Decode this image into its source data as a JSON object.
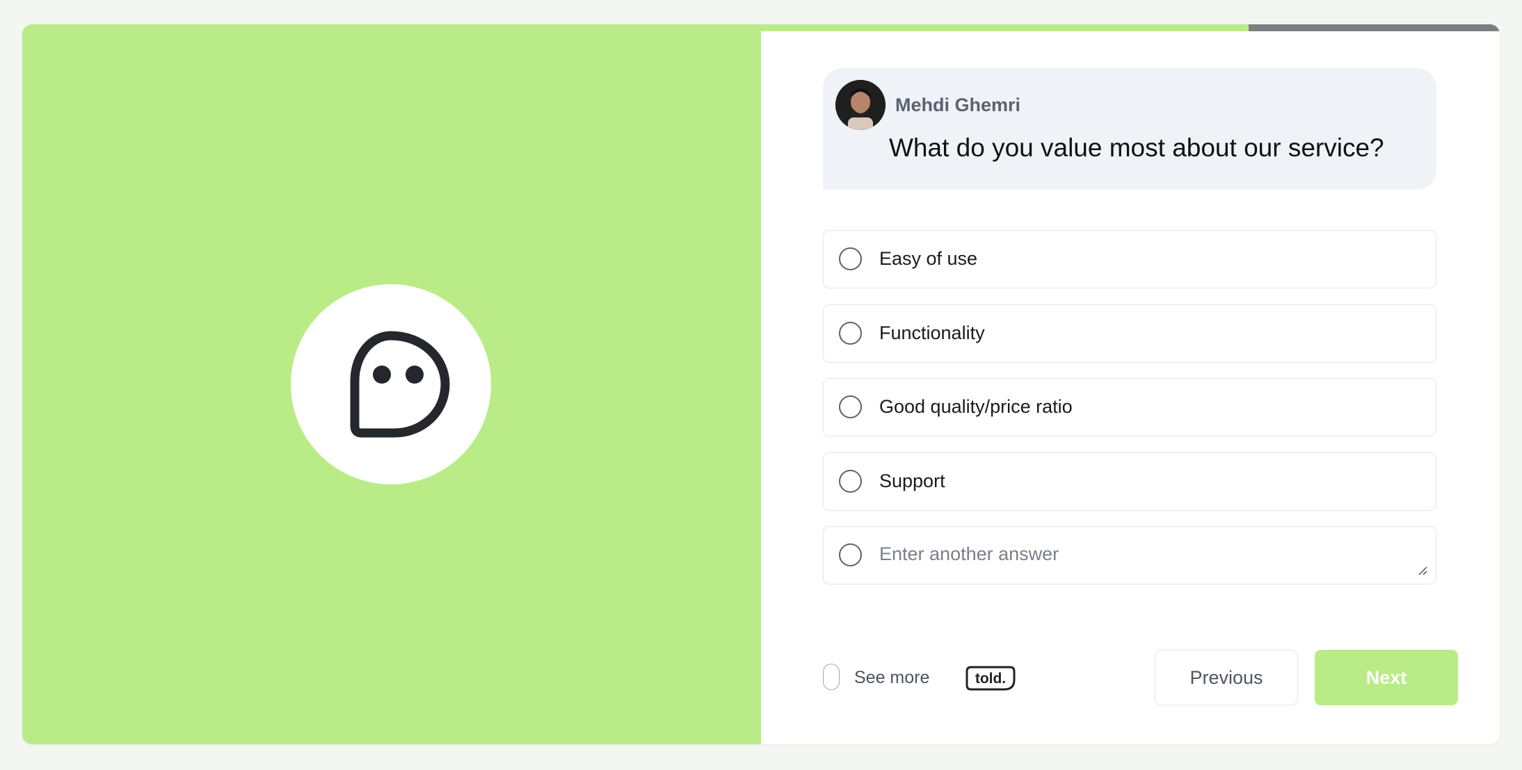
{
  "colors": {
    "accent": "#b9ec87",
    "progress_remaining": "#7b7f80",
    "question_bg": "#eff3f8"
  },
  "progress": 0.66,
  "question": {
    "author": "Mehdi Ghemri",
    "text": "What do you value most about our service?"
  },
  "options": [
    {
      "label": "Easy of use"
    },
    {
      "label": "Functionality"
    },
    {
      "label": "Good quality/price ratio"
    },
    {
      "label": "Support"
    }
  ],
  "other_answer": {
    "placeholder": "Enter another answer",
    "value": ""
  },
  "footer": {
    "see_more_label": "See more",
    "brand_logo": "told."
  },
  "buttons": {
    "previous": "Previous",
    "next": "Next"
  },
  "icons": {
    "logo": "chat-bubble-face-icon",
    "radio": "radio-unchecked-icon",
    "resize": "resize-grip-icon"
  }
}
